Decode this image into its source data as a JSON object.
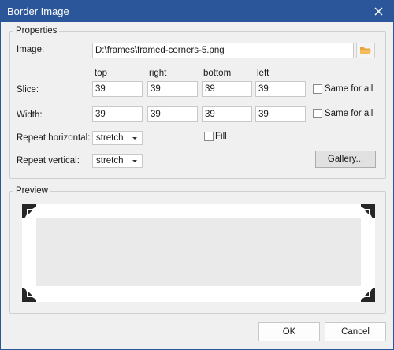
{
  "window": {
    "title": "Border Image"
  },
  "properties": {
    "group_label": "Properties",
    "image_label": "Image:",
    "image_value": "D:\\frames\\framed-corners-5.png",
    "col_headers": [
      "top",
      "right",
      "bottom",
      "left"
    ],
    "slice": {
      "label": "Slice:",
      "values": [
        "39",
        "39",
        "39",
        "39"
      ],
      "same_label": "Same for all"
    },
    "width": {
      "label": "Width:",
      "values": [
        "39",
        "39",
        "39",
        "39"
      ],
      "same_label": "Same for all"
    },
    "repeat_horizontal": {
      "label": "Repeat horizontal:",
      "value": "stretch"
    },
    "repeat_vertical": {
      "label": "Repeat vertical:",
      "value": "stretch"
    },
    "fill_label": "Fill",
    "gallery_label": "Gallery..."
  },
  "preview": {
    "group_label": "Preview"
  },
  "buttons": {
    "ok": "OK",
    "cancel": "Cancel"
  },
  "colors": {
    "titlebar": "#2b579a",
    "folder_icon": "#e8a33d"
  }
}
